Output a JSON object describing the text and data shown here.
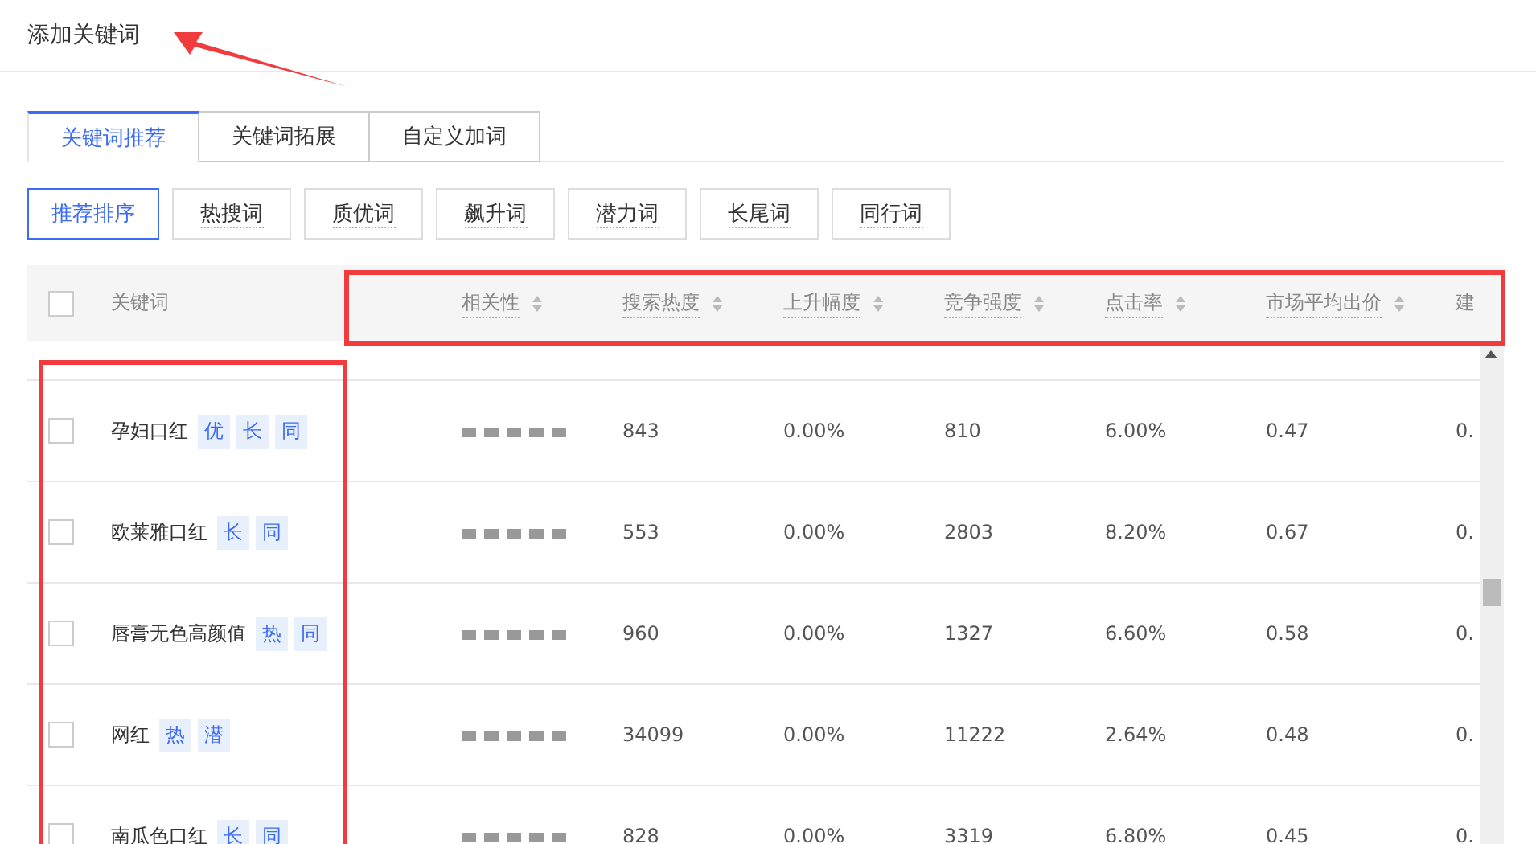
{
  "title": "添加关键词",
  "tabs": [
    {
      "label": "关键词推荐",
      "selected": true
    },
    {
      "label": "关键词拓展",
      "selected": false
    },
    {
      "label": "自定义加词",
      "selected": false
    }
  ],
  "filters": [
    {
      "label": "推荐排序",
      "selected": true
    },
    {
      "label": "热搜词",
      "selected": false
    },
    {
      "label": "质优词",
      "selected": false
    },
    {
      "label": "飙升词",
      "selected": false
    },
    {
      "label": "潜力词",
      "selected": false
    },
    {
      "label": "长尾词",
      "selected": false
    },
    {
      "label": "同行词",
      "selected": false
    }
  ],
  "table": {
    "select_all_checked": false,
    "columns": [
      {
        "label": "关键词",
        "sortable": false
      },
      {
        "label": "相关性",
        "sortable": true
      },
      {
        "label": "搜索热度",
        "sortable": true
      },
      {
        "label": "上升幅度",
        "sortable": true
      },
      {
        "label": "竞争强度",
        "sortable": true
      },
      {
        "label": "点击率",
        "sortable": true
      },
      {
        "label": "市场平均出价",
        "sortable": true
      },
      {
        "label": "建",
        "sortable": false
      }
    ],
    "rows": [
      {
        "checked": false,
        "keyword": "孕妇口红",
        "tags": [
          "优",
          "长",
          "同"
        ],
        "stars": 5,
        "search_heat": "843",
        "rise": "0.00%",
        "competition": "810",
        "ctr": "6.00%",
        "market_avg_bid": "0.47",
        "column_8": "0."
      },
      {
        "checked": false,
        "keyword": "欧莱雅口红",
        "tags": [
          "长",
          "同"
        ],
        "stars": 5,
        "search_heat": "553",
        "rise": "0.00%",
        "competition": "2803",
        "ctr": "8.20%",
        "market_avg_bid": "0.67",
        "column_8": "0."
      },
      {
        "checked": false,
        "keyword": "唇膏无色高颜值",
        "tags": [
          "热",
          "同"
        ],
        "stars": 5,
        "search_heat": "960",
        "rise": "0.00%",
        "competition": "1327",
        "ctr": "6.60%",
        "market_avg_bid": "0.58",
        "column_8": "0."
      },
      {
        "checked": false,
        "keyword": "网红",
        "tags": [
          "热",
          "潜"
        ],
        "stars": 5,
        "search_heat": "34099",
        "rise": "0.00%",
        "competition": "11222",
        "ctr": "2.64%",
        "market_avg_bid": "0.48",
        "column_8": "0."
      },
      {
        "checked": false,
        "keyword": "南瓜色口红",
        "tags": [
          "长",
          "同"
        ],
        "stars": 5,
        "search_heat": "828",
        "rise": "0.00%",
        "competition": "3319",
        "ctr": "6.80%",
        "market_avg_bid": "0.45",
        "column_8": "0."
      }
    ]
  }
}
